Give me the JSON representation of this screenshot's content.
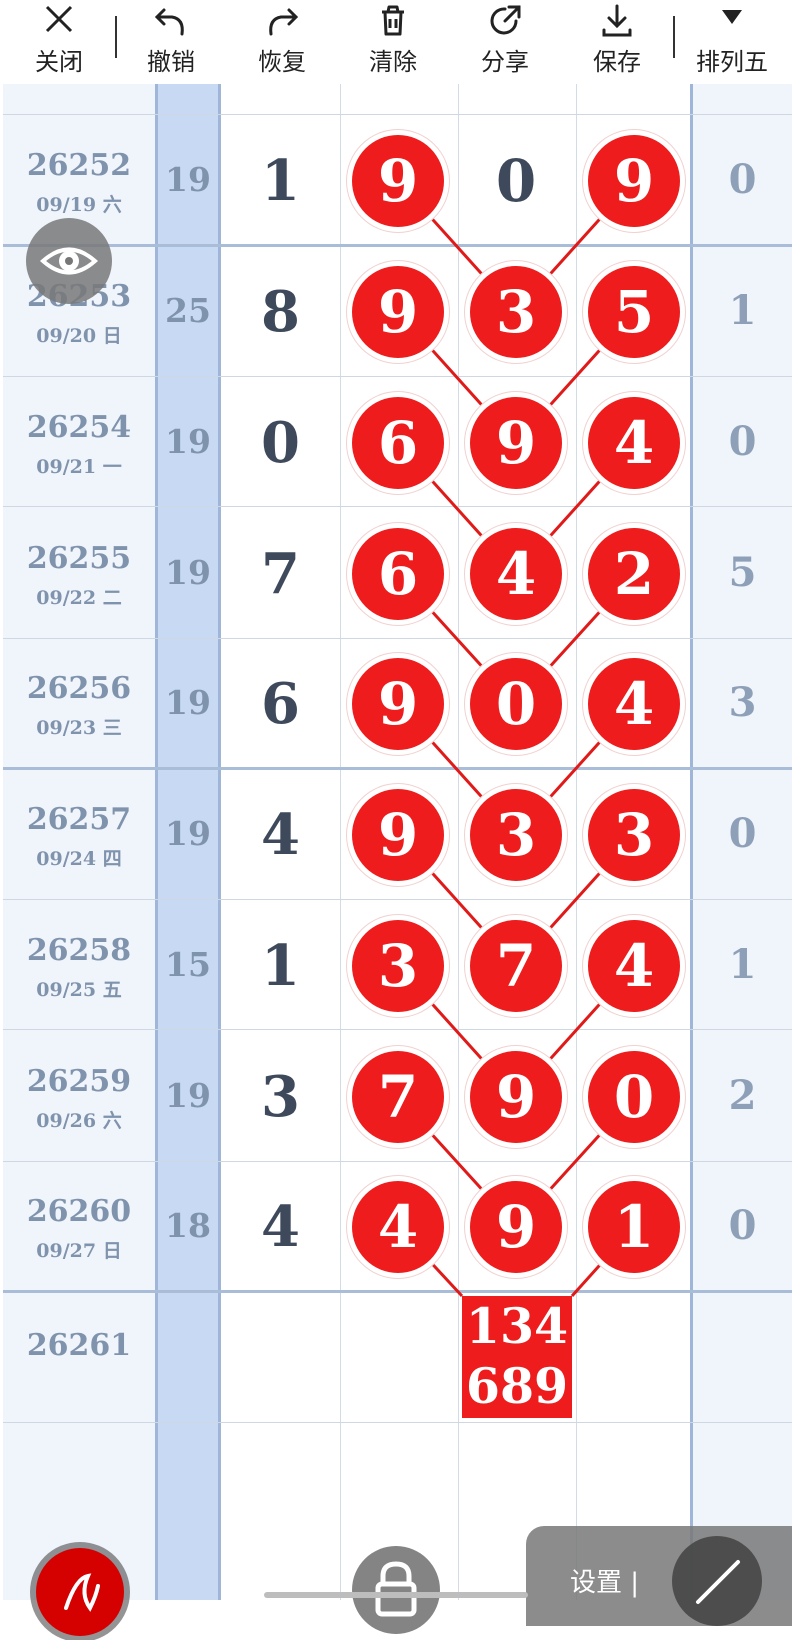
{
  "toolbar": {
    "close": "关闭",
    "undo": "撤销",
    "redo": "恢复",
    "clear": "清除",
    "share": "分享",
    "save": "保存",
    "lottery": "排列五"
  },
  "rows": [
    {
      "issue": "26252",
      "date": "09/19 六",
      "sum": "19",
      "d1": "1",
      "b1": "9",
      "b2": "0",
      "b3": "9",
      "right": "0"
    },
    {
      "issue": "26253",
      "date": "09/20 日",
      "sum": "25",
      "d1": "8",
      "b1": "9",
      "b2": "3",
      "b3": "5",
      "right": "1"
    },
    {
      "issue": "26254",
      "date": "09/21 一",
      "sum": "19",
      "d1": "0",
      "b1": "6",
      "b2": "9",
      "b3": "4",
      "right": "0"
    },
    {
      "issue": "26255",
      "date": "09/22 二",
      "sum": "19",
      "d1": "7",
      "b1": "6",
      "b2": "4",
      "b3": "2",
      "right": "5"
    },
    {
      "issue": "26256",
      "date": "09/23 三",
      "sum": "19",
      "d1": "6",
      "b1": "9",
      "b2": "0",
      "b3": "4",
      "right": "3"
    },
    {
      "issue": "26257",
      "date": "09/24 四",
      "sum": "19",
      "d1": "4",
      "b1": "9",
      "b2": "3",
      "b3": "3",
      "right": "0"
    },
    {
      "issue": "26258",
      "date": "09/25 五",
      "sum": "15",
      "d1": "1",
      "b1": "3",
      "b2": "7",
      "b3": "4",
      "right": "1"
    },
    {
      "issue": "26259",
      "date": "09/26 六",
      "sum": "19",
      "d1": "3",
      "b1": "7",
      "b2": "9",
      "b3": "0",
      "right": "2"
    },
    {
      "issue": "26260",
      "date": "09/27 日",
      "sum": "18",
      "d1": "4",
      "b1": "4",
      "b2": "9",
      "b3": "1",
      "right": "0"
    }
  ],
  "next_issue": "26261",
  "prediction": {
    "line1": "134",
    "line2": "689"
  },
  "bottom_bar": {
    "settings_label": "设置 |"
  },
  "colors": {
    "ball": "#ee1c1c",
    "sum_column": "#c8daf3",
    "side_column": "#f0f4fb",
    "text_gray": "#7f93ad"
  }
}
